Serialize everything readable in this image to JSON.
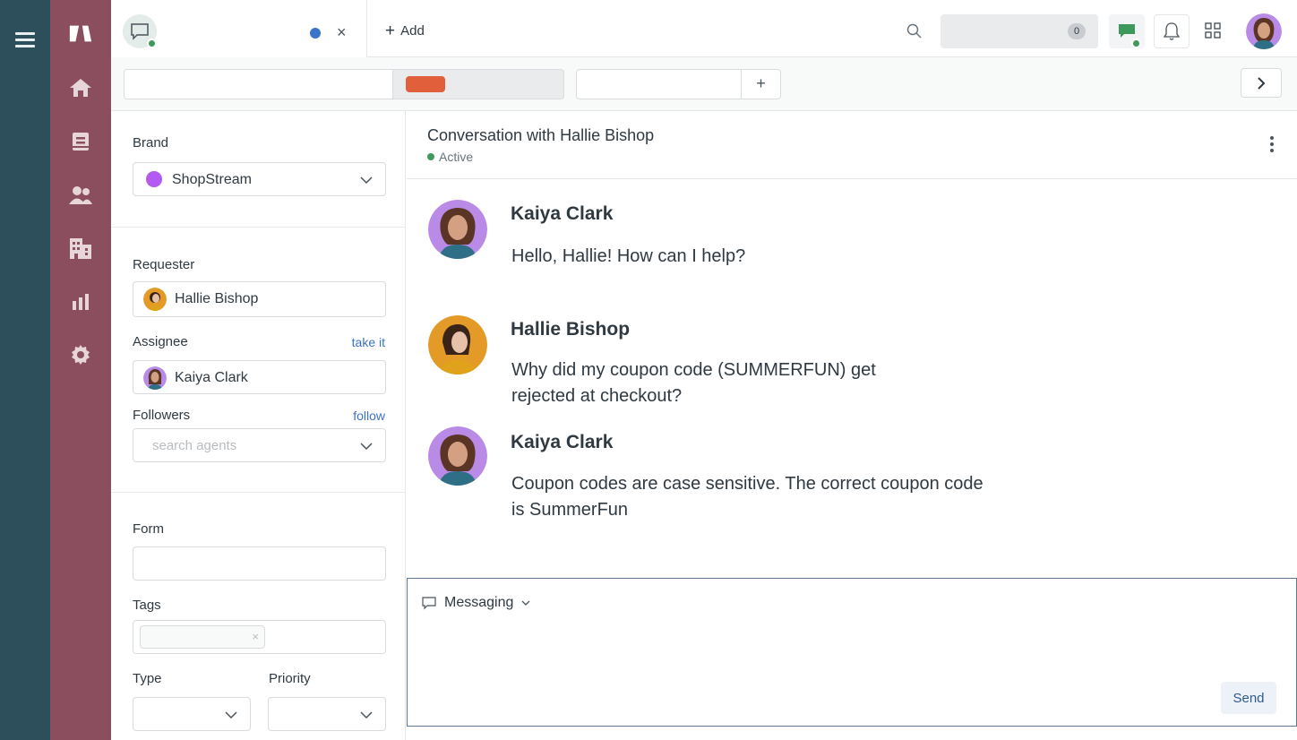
{
  "topbar": {
    "add_label": "Add",
    "notification_count": "0"
  },
  "left_panel": {
    "brand_label": "Brand",
    "brand_value": "ShopStream",
    "requester_label": "Requester",
    "requester_value": "Hallie Bishop",
    "assignee_label": "Assignee",
    "assignee_link": "take it",
    "assignee_value": "Kaiya Clark",
    "followers_label": "Followers",
    "followers_link": "follow",
    "followers_placeholder": "search agents",
    "form_label": "Form",
    "tags_label": "Tags",
    "type_label": "Type",
    "priority_label": "Priority"
  },
  "conversation": {
    "title": "Conversation with Hallie Bishop",
    "status": "Active",
    "messages": [
      {
        "author": "Kaiya Clark",
        "text": "Hello, Hallie! How can I help?"
      },
      {
        "author": "Hallie Bishop",
        "text": "Why did my coupon code (SUMMERFUN) get rejected at checkout?"
      },
      {
        "author": "Kaiya Clark",
        "text": "Coupon codes are case sensitive. The correct coupon code is SummerFun"
      }
    ]
  },
  "composer": {
    "channel": "Messaging",
    "send_label": "Send"
  },
  "colors": {
    "rail": "#2d4f5c",
    "nav": "#8a4e5e",
    "brand_dot": "#b35bf0",
    "status_green": "#3d9a5b",
    "link_blue": "#3b73c6",
    "tag_orange": "#e15f3a"
  },
  "icons": {
    "nav": [
      "logo-icon",
      "home-icon",
      "tickets-icon",
      "users-icon",
      "organizations-icon",
      "reports-icon",
      "settings-icon"
    ]
  }
}
